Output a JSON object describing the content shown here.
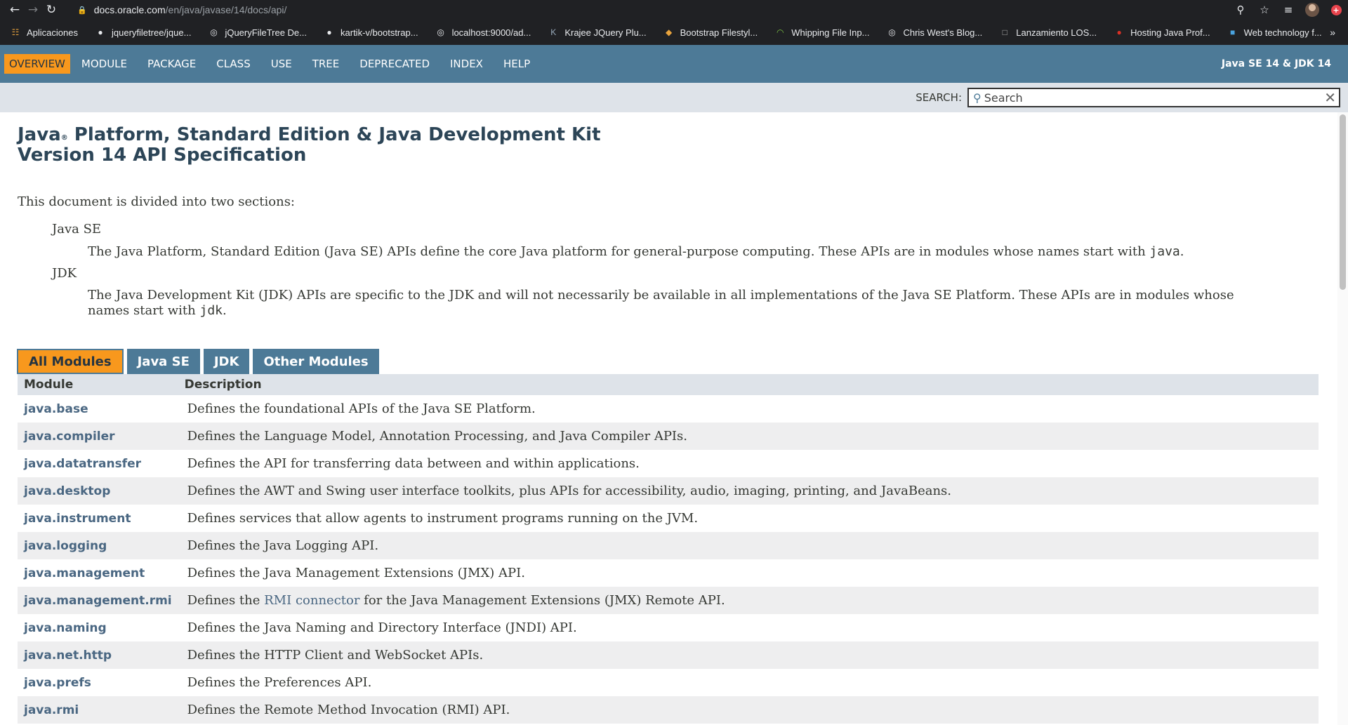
{
  "browser": {
    "url_host": "docs.oracle.com",
    "url_path": "/en/java/javase/14/docs/api/",
    "bookmarks": [
      {
        "label": "Aplicaciones",
        "icon": "apps-grid-icon"
      },
      {
        "label": "jqueryfiletree/jque...",
        "icon": "github-icon"
      },
      {
        "label": "jQueryFileTree De...",
        "icon": "globe-icon"
      },
      {
        "label": "kartik-v/bootstrap...",
        "icon": "github-icon"
      },
      {
        "label": "localhost:9000/ad...",
        "icon": "globe-icon"
      },
      {
        "label": "Krajee JQuery Plu...",
        "icon": "krajee-icon"
      },
      {
        "label": "Bootstrap Filestyl...",
        "icon": "bootstrap-filestyle-icon"
      },
      {
        "label": "Whipping File Inp...",
        "icon": "whipping-icon"
      },
      {
        "label": "Chris West's Blog...",
        "icon": "globe-icon"
      },
      {
        "label": "Lanzamiento LOS...",
        "icon": "page-icon"
      },
      {
        "label": "Hosting Java Prof...",
        "icon": "hosting-icon"
      },
      {
        "label": "Web technology f...",
        "icon": "web-tech-icon"
      }
    ]
  },
  "nav": {
    "items": [
      "OVERVIEW",
      "MODULE",
      "PACKAGE",
      "CLASS",
      "USE",
      "TREE",
      "DEPRECATED",
      "INDEX",
      "HELP"
    ],
    "about": "Java SE 14 & JDK 14"
  },
  "search": {
    "label": "SEARCH:",
    "placeholder": "Search"
  },
  "header": {
    "title_java": "Java",
    "title_reg": "®",
    "title_rest": " Platform, Standard Edition & Java Development Kit",
    "title_line2": "Version 14 API Specification"
  },
  "intro": {
    "text": "This document is divided into two sections:",
    "javase_term": "Java SE",
    "javase_desc": "The Java Platform, Standard Edition (Java SE) APIs define the core Java platform for general-purpose computing. These APIs are in modules whose names start with ",
    "javase_code": "java",
    "javase_end": ".",
    "jdk_term": "JDK",
    "jdk_desc": "The Java Development Kit (JDK) APIs are specific to the JDK and will not necessarily be available in all implementations of the Java SE Platform. These APIs are in modules whose names start with ",
    "jdk_code": "jdk",
    "jdk_end": "."
  },
  "tabs": [
    "All Modules",
    "Java SE",
    "JDK",
    "Other Modules"
  ],
  "table": {
    "headers": [
      "Module",
      "Description"
    ],
    "rows": [
      {
        "module": "java.base",
        "description": "Defines the foundational APIs of the Java SE Platform."
      },
      {
        "module": "java.compiler",
        "description": "Defines the Language Model, Annotation Processing, and Java Compiler APIs."
      },
      {
        "module": "java.datatransfer",
        "description": "Defines the API for transferring data between and within applications."
      },
      {
        "module": "java.desktop",
        "description": "Defines the AWT and Swing user interface toolkits, plus APIs for accessibility, audio, imaging, printing, and JavaBeans."
      },
      {
        "module": "java.instrument",
        "description": "Defines services that allow agents to instrument programs running on the JVM."
      },
      {
        "module": "java.logging",
        "description": "Defines the Java Logging API."
      },
      {
        "module": "java.management",
        "description": "Defines the Java Management Extensions (JMX) API."
      },
      {
        "module": "java.management.rmi",
        "desc_pre": "Defines the ",
        "desc_link": "RMI connector",
        "desc_post": " for the Java Management Extensions (JMX) Remote API."
      },
      {
        "module": "java.naming",
        "description": "Defines the Java Naming and Directory Interface (JNDI) API."
      },
      {
        "module": "java.net.http",
        "description": "Defines the HTTP Client and WebSocket APIs."
      },
      {
        "module": "java.prefs",
        "description": "Defines the Preferences API."
      },
      {
        "module": "java.rmi",
        "description": "Defines the Remote Method Invocation (RMI) API."
      }
    ]
  },
  "colors": {
    "nav_bg": "#4d7a97",
    "accent_orange": "#f8981d",
    "heading": "#2c4557",
    "link": "#4a6782"
  }
}
